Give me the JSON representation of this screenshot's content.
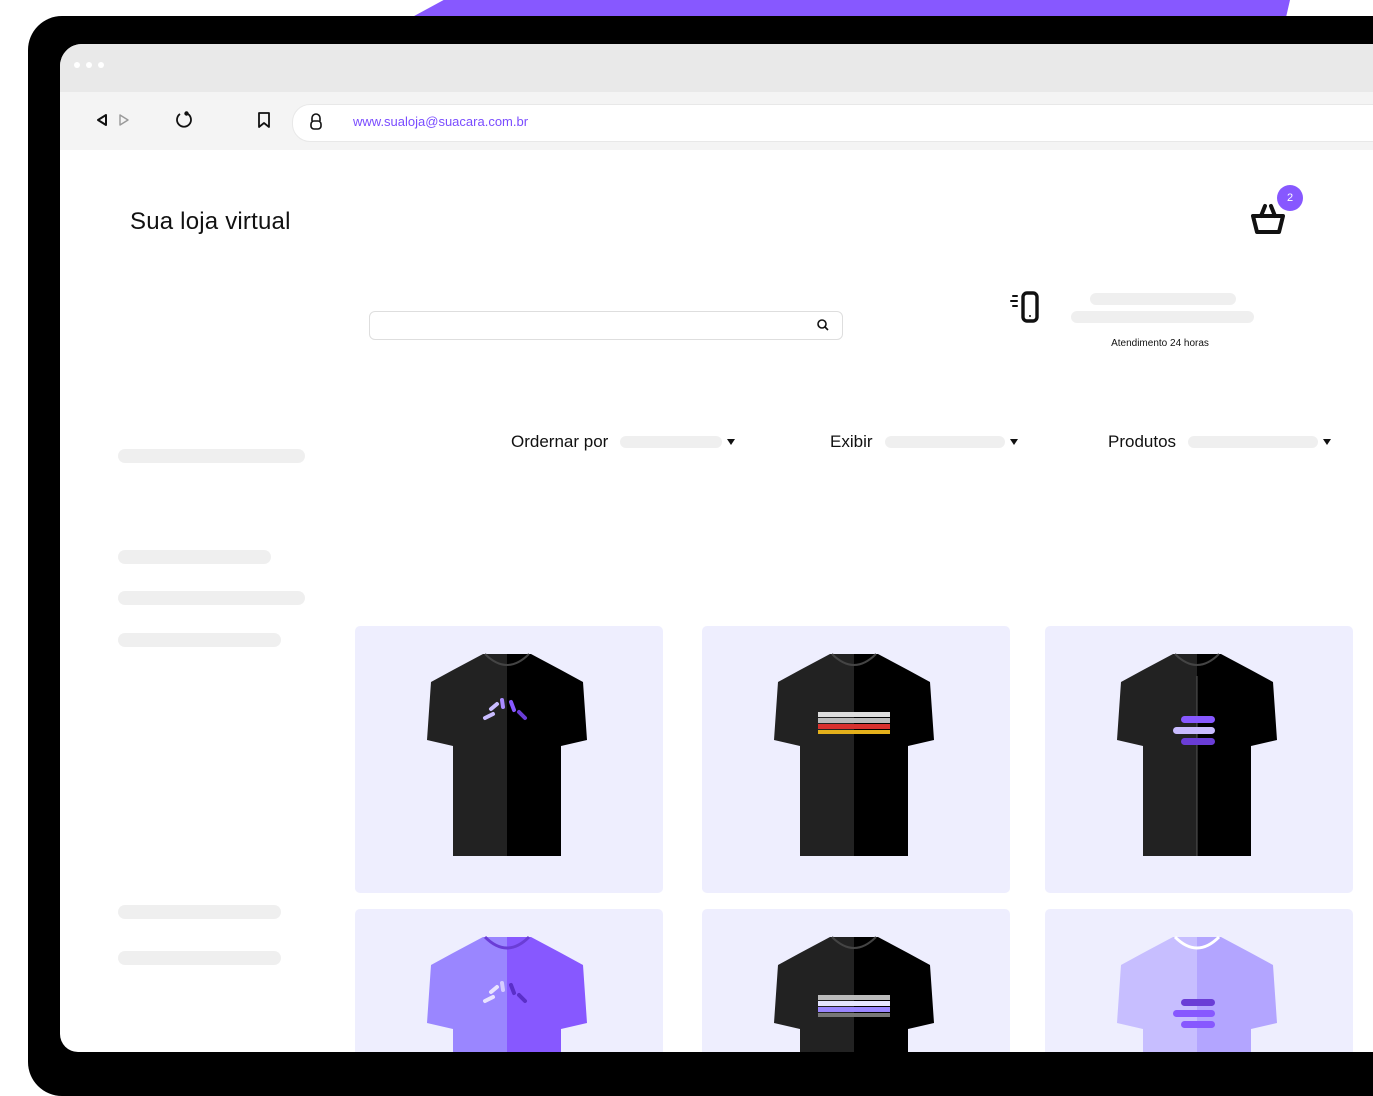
{
  "browser": {
    "url": "www.sualoja@suacara.com.br",
    "nav_icons": [
      "back-arrow-icon",
      "forward-arrow-icon",
      "reload-icon",
      "bookmark-icon",
      "lock-icon"
    ]
  },
  "store": {
    "logo": "Sua loja virtual",
    "cart_count": "2",
    "support_label": "Atendimento 24 horas"
  },
  "search": {
    "placeholder": ""
  },
  "filters": [
    {
      "label": "Ordernar por"
    },
    {
      "label": "Exibir"
    },
    {
      "label": "Produtos"
    }
  ],
  "products": [
    {
      "shirt_color": "black",
      "print": "spinner-icon"
    },
    {
      "shirt_color": "black",
      "print": "stripes-icon"
    },
    {
      "shirt_color": "black",
      "print": "menu-bars-icon"
    },
    {
      "shirt_color": "purple",
      "print": "spinner-icon"
    },
    {
      "shirt_color": "black",
      "print": "stripes-icon"
    },
    {
      "shirt_color": "lavender",
      "print": "menu-bars-icon"
    }
  ],
  "colors": {
    "accent": "#8758ff",
    "card_bg": "#eeeefe",
    "skeleton": "#efefef"
  }
}
